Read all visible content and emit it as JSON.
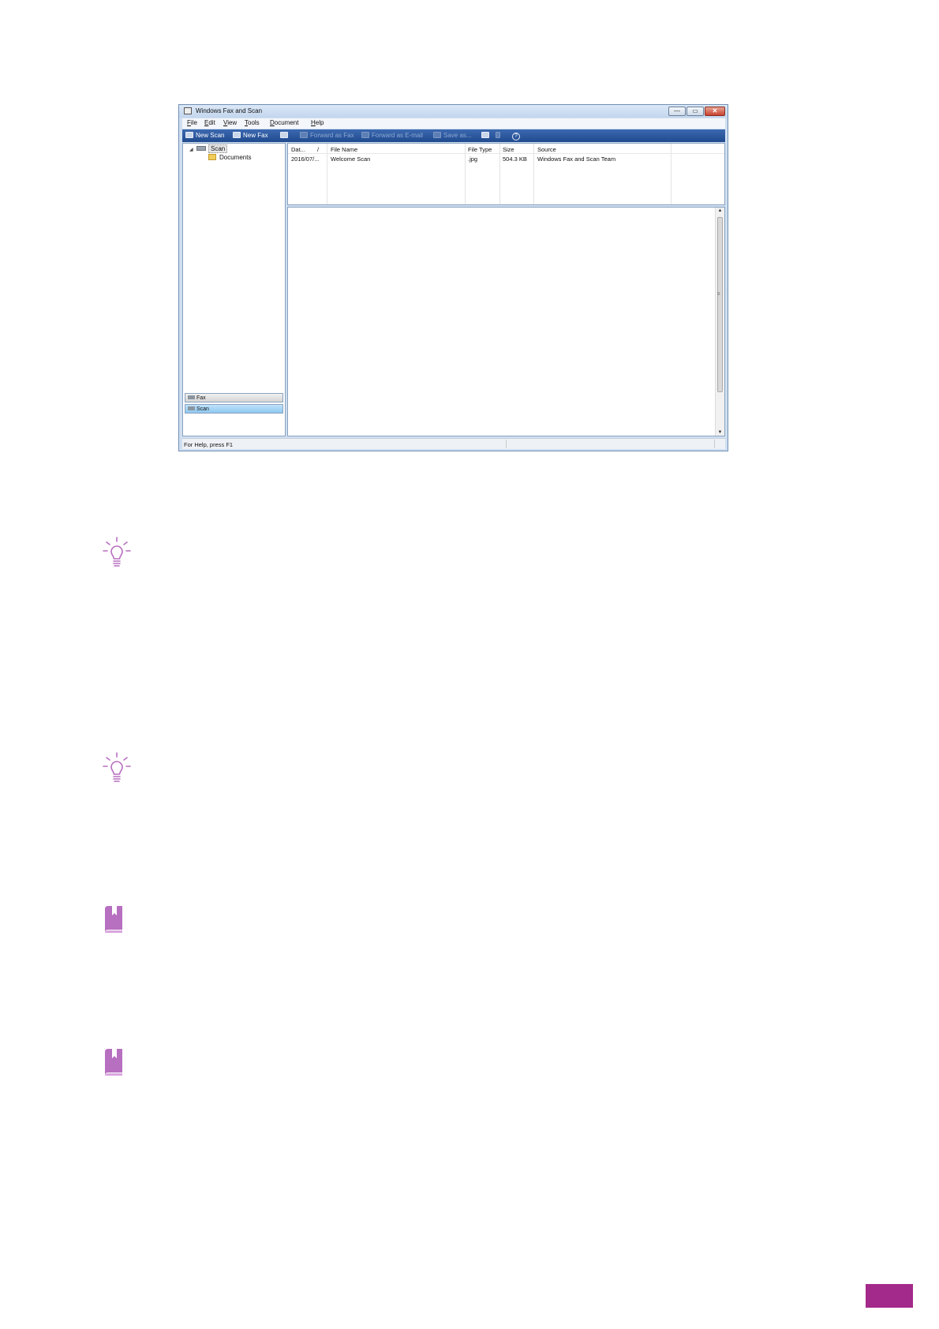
{
  "window": {
    "title": "Windows Fax and Scan",
    "controls": {
      "minimize": "—",
      "maximize": "▭",
      "close": "✕"
    }
  },
  "menubar": [
    "File",
    "Edit",
    "View",
    "Tools",
    "Document",
    "Help"
  ],
  "toolbar": {
    "new_scan": "New Scan",
    "new_fax": "New Fax",
    "forward_fax": "Forward as Fax",
    "forward_email": "Forward as E-mail",
    "save_as": "Save as...",
    "help_glyph": "?"
  },
  "tree": {
    "root": "Scan",
    "child": "Documents"
  },
  "nav_tabs": {
    "fax": "Fax",
    "scan": "Scan"
  },
  "list": {
    "headers": [
      "Dat...",
      "File Name",
      "File Type",
      "Size",
      "Source"
    ],
    "sort_glyph": "/",
    "rows": [
      [
        "2016/07/...",
        "Welcome Scan",
        ".jpg",
        "504.3 KB",
        "Windows Fax and Scan Team"
      ]
    ]
  },
  "status": {
    "text": "For Help, press F1"
  },
  "icons": {
    "tip_1": "lightbulb-icon",
    "tip_2": "lightbulb-icon",
    "note_1": "book-icon",
    "note_2": "book-icon"
  },
  "colors": {
    "accent": "#a3298a",
    "icon_purple": "#b76fc0",
    "toolbar_blue": "#2a56a0"
  }
}
